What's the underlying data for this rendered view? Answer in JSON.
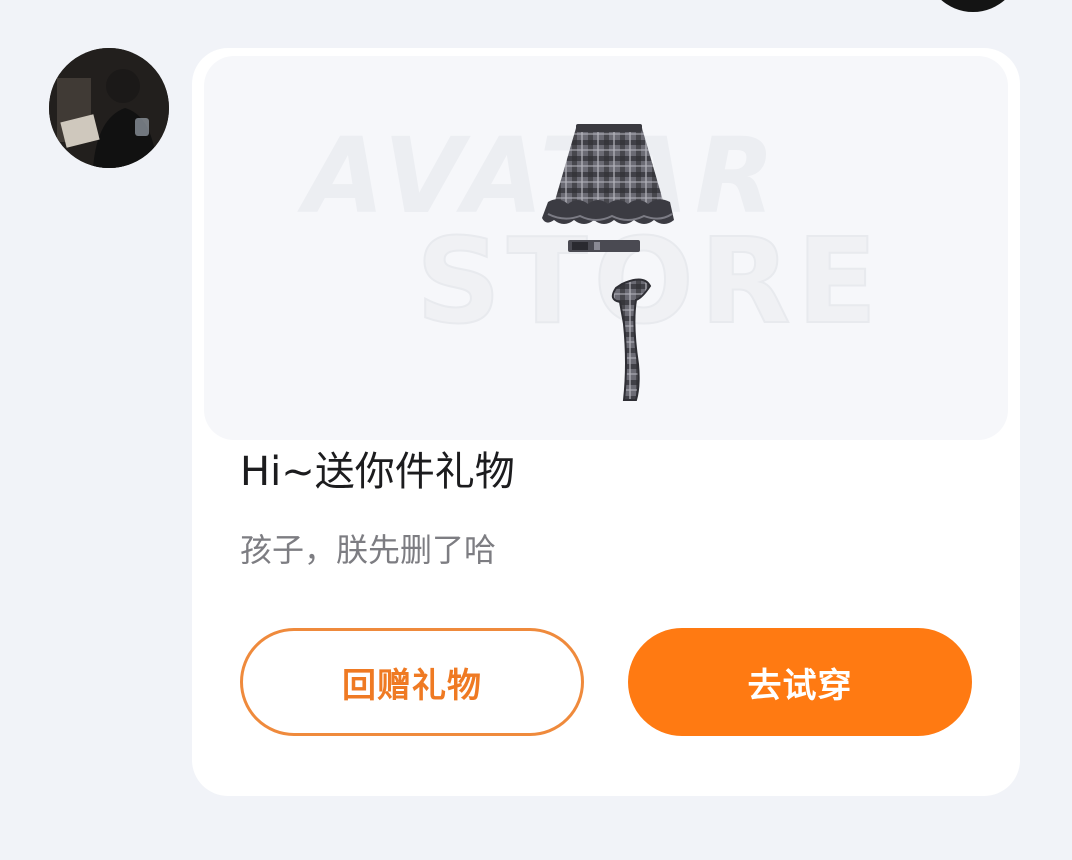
{
  "gift_card": {
    "preview": {
      "watermark_line1": "AVATAR",
      "watermark_line2": "STORE",
      "item_icon": "plaid-skirt-outfit-icon"
    },
    "title": "Hi~送你件礼物",
    "message": "孩子，朕先删了哈",
    "return_gift_label": "回赠礼物",
    "try_on_label": "去试穿"
  },
  "colors": {
    "accent": "#ff7a12",
    "accent_outline": "#ef8a3c",
    "page_bg": "#f1f3f8",
    "card_bg": "#ffffff"
  }
}
